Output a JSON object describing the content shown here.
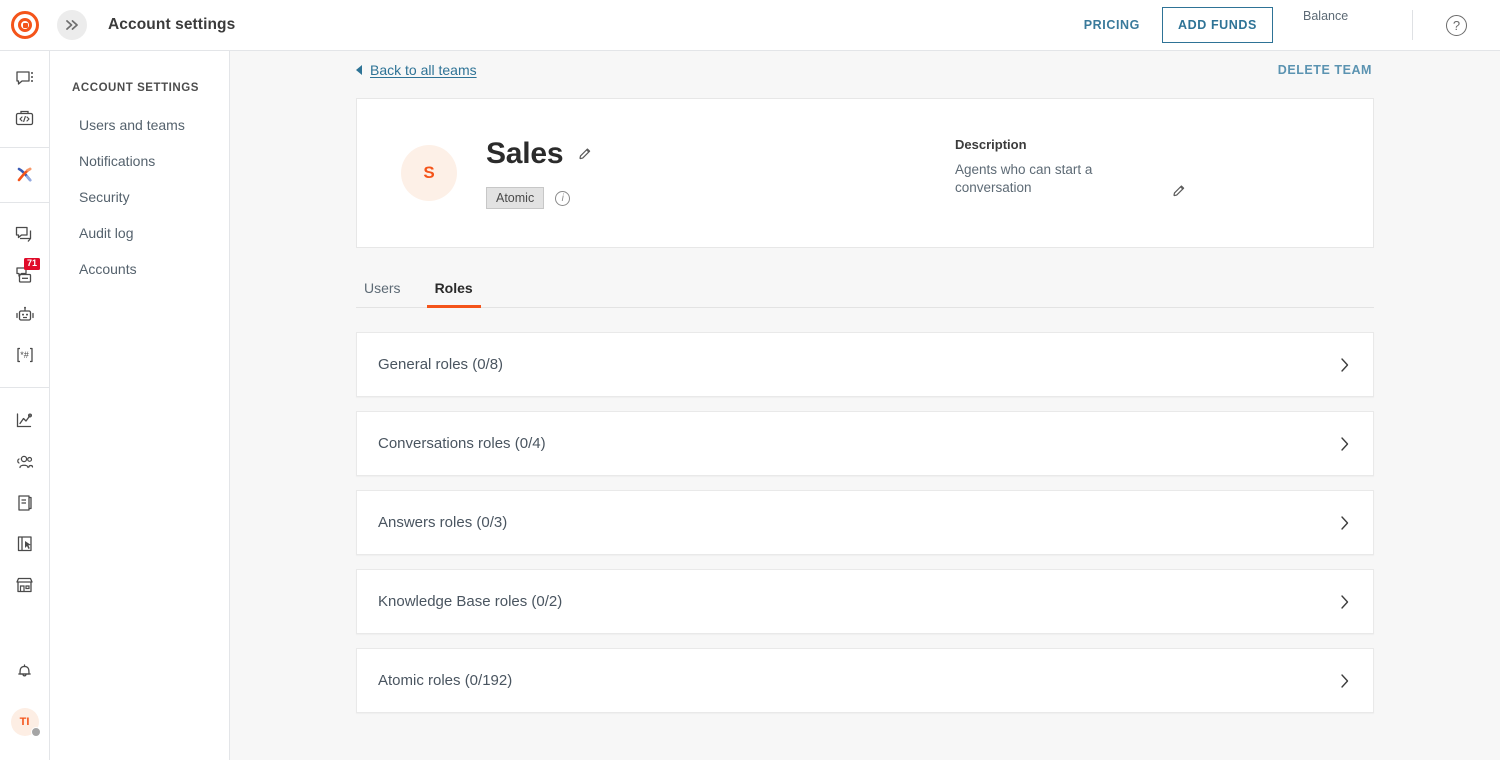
{
  "topbar": {
    "logo": "target-logo",
    "expand_button": "expand-sidebar-icon",
    "title": "Account settings",
    "pricing_label": "PRICING",
    "add_funds_label": "ADD FUNDS",
    "balance_label": "Balance",
    "help_icon": "?"
  },
  "rail": {
    "items": [
      {
        "icon": "conversations-icon",
        "badge": ""
      },
      {
        "icon": "developer-toolbox-icon",
        "badge": ""
      },
      {
        "icon": "atomic-x-icon",
        "badge": ""
      },
      {
        "icon": "copy-messages-icon",
        "badge": ""
      },
      {
        "icon": "inbox-icon",
        "badge": "71"
      },
      {
        "icon": "bot-icon",
        "badge": ""
      },
      {
        "icon": "keywords-icon",
        "badge": ""
      },
      {
        "icon": "analytics-icon",
        "badge": ""
      },
      {
        "icon": "contacts-icon",
        "badge": ""
      },
      {
        "icon": "knowledge-base-icon",
        "badge": ""
      },
      {
        "icon": "templates-icon",
        "badge": ""
      },
      {
        "icon": "marketplace-icon",
        "badge": ""
      }
    ],
    "notifications_icon": "bell-icon",
    "avatar_initials": "TI"
  },
  "settings_nav": {
    "heading": "ACCOUNT SETTINGS",
    "items": [
      {
        "label": "Users and teams"
      },
      {
        "label": "Notifications"
      },
      {
        "label": "Security"
      },
      {
        "label": "Audit log"
      },
      {
        "label": "Accounts"
      }
    ]
  },
  "main": {
    "back_link": "Back to all teams",
    "delete_team": "DELETE TEAM",
    "team": {
      "avatar_initial": "S",
      "name": "Sales",
      "chip": "Atomic",
      "description_label": "Description",
      "description_text": "Agents who can start a conversation"
    },
    "tabs": [
      {
        "label": "Users",
        "active": false
      },
      {
        "label": "Roles",
        "active": true
      }
    ],
    "roles": [
      {
        "label": "General roles (0/8)"
      },
      {
        "label": "Conversations roles (0/4)"
      },
      {
        "label": "Answers roles (0/3)"
      },
      {
        "label": "Knowledge Base roles (0/2)"
      },
      {
        "label": "Atomic roles (0/192)"
      }
    ]
  },
  "colors": {
    "accent_orange": "#f4541a",
    "link_blue": "#2e7396",
    "badge_red": "#e00b29",
    "page_bg": "#f7f7f7"
  }
}
